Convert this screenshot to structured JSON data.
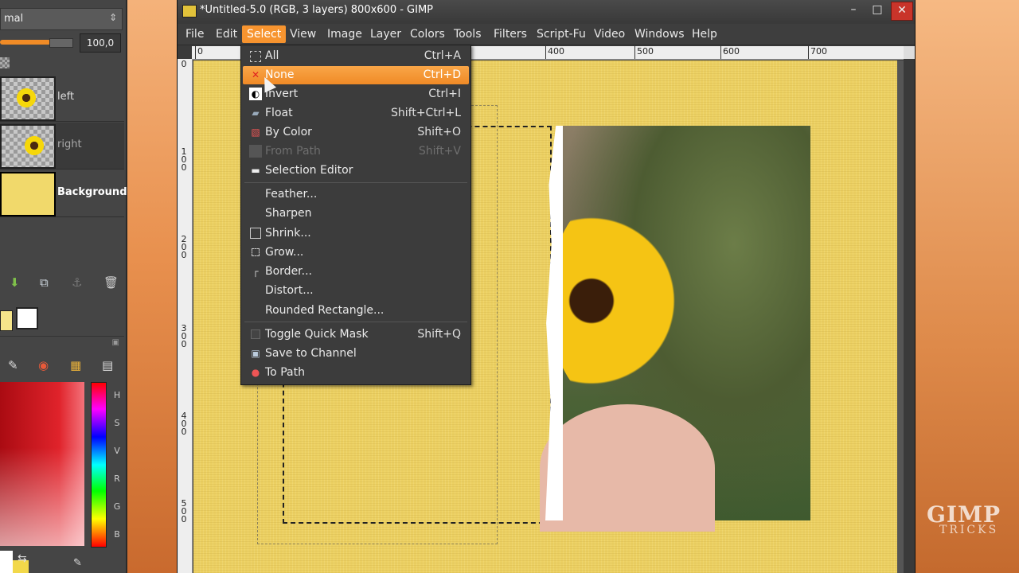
{
  "layers_panel": {
    "mode": "mal",
    "opacity": "100,0",
    "layers": [
      {
        "name": "left"
      },
      {
        "name": "right"
      },
      {
        "name": "Background"
      }
    ]
  },
  "color_panel": {
    "channels": [
      "H",
      "S",
      "V",
      "R",
      "G",
      "B"
    ]
  },
  "window": {
    "title": "*Untitled-5.0 (RGB, 3 layers) 800x600 - GIMP",
    "min": "–",
    "max": "□",
    "close": "✕"
  },
  "menubar": [
    "File",
    "Edit",
    "Select",
    "View",
    "Image",
    "Layer",
    "Colors",
    "Tools",
    "Filters",
    "Script-Fu",
    "Video",
    "Windows",
    "Help"
  ],
  "ruler": {
    "h_ticks": [
      "0",
      "400",
      "500",
      "600",
      "700"
    ],
    "v_ticks": [
      "0",
      "1\n0\n0",
      "2\n0\n0",
      "3\n0\n0",
      "4\n0\n0",
      "5\n0\n0"
    ]
  },
  "select_menu": {
    "items": [
      {
        "label": "All",
        "accel": "Ctrl+A",
        "icon": "select-all-icon"
      },
      {
        "label": "None",
        "accel": "Ctrl+D",
        "icon": "select-none-icon"
      },
      {
        "label": "Invert",
        "accel": "Ctrl+I",
        "icon": "invert-icon"
      },
      {
        "label": "Float",
        "accel": "Shift+Ctrl+L",
        "icon": "float-icon"
      },
      {
        "label": "By Color",
        "accel": "Shift+O",
        "icon": "by-color-icon"
      },
      {
        "label": "From Path",
        "accel": "Shift+V",
        "icon": "from-path-icon"
      },
      {
        "label": "Selection Editor",
        "accel": "",
        "icon": "selection-editor-icon"
      },
      {
        "label": "Feather...",
        "accel": ""
      },
      {
        "label": "Sharpen",
        "accel": ""
      },
      {
        "label": "Shrink...",
        "accel": "",
        "icon": "shrink-icon"
      },
      {
        "label": "Grow...",
        "accel": "",
        "icon": "grow-icon"
      },
      {
        "label": "Border...",
        "accel": "",
        "icon": "border-icon"
      },
      {
        "label": "Distort...",
        "accel": ""
      },
      {
        "label": "Rounded Rectangle...",
        "accel": ""
      },
      {
        "label": "Toggle Quick Mask",
        "accel": "Shift+Q",
        "icon": "quick-mask-icon"
      },
      {
        "label": "Save to Channel",
        "accel": "",
        "icon": "save-channel-icon"
      },
      {
        "label": "To Path",
        "accel": "",
        "icon": "to-path-icon"
      }
    ]
  },
  "watermark": {
    "title": "GIMP",
    "subtitle": "TRICKS"
  },
  "colors": {
    "accent": "#f7942f",
    "canvas": "#ecd062",
    "menu_bg": "#3c3c3c"
  }
}
